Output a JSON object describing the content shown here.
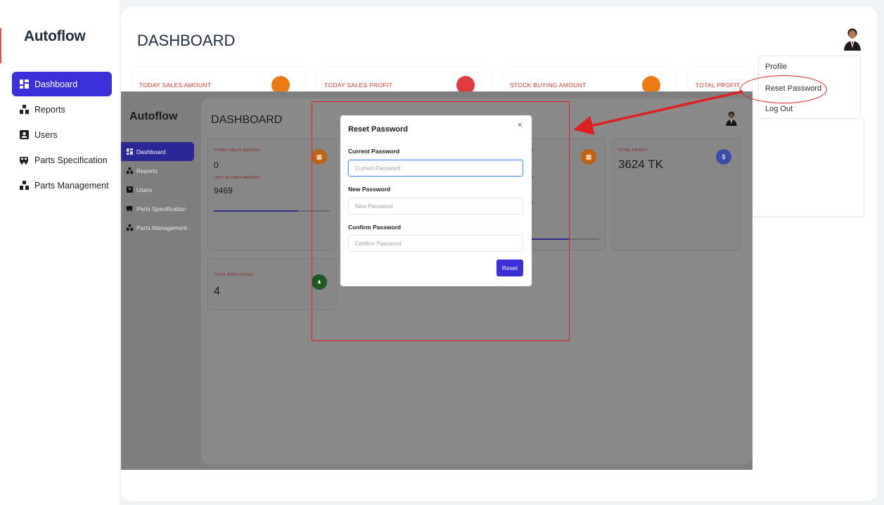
{
  "app": {
    "name": "Autoflow",
    "page_title": "DASHBOARD"
  },
  "sidebar": {
    "items": [
      {
        "label": "Dashboard",
        "icon": "dashboard-icon",
        "active": true
      },
      {
        "label": "Reports",
        "icon": "reports-icon",
        "active": false
      },
      {
        "label": "Users",
        "icon": "users-icon",
        "active": false
      },
      {
        "label": "Parts Specification",
        "icon": "car-icon",
        "active": false
      },
      {
        "label": "Parts Management",
        "icon": "parts-icon",
        "active": false
      }
    ]
  },
  "cards": [
    {
      "label": "TODAY SALES AMOUNT",
      "color": "#f07a12"
    },
    {
      "label": "TODAY SALES PROFIT",
      "color": "#e0393e"
    },
    {
      "label": "STOCK BUYING AMOUNT",
      "color": "#f07a12"
    },
    {
      "label": "TOTAL PROFIT",
      "color": "#4a5fe0"
    }
  ],
  "profile_menu": {
    "items": [
      "Profile",
      "Reset Password",
      "Log Out"
    ],
    "highlighted": "Reset Password"
  },
  "overlay": {
    "app_name": "Autoflow",
    "page_title": "DASHBOARD",
    "sidebar": [
      "Dashboard",
      "Reports",
      "Users",
      "Parts Specification",
      "Parts Management"
    ],
    "card_sales": {
      "label": "TODAY SALES AMOUNT",
      "value": "0",
      "sub_label": "LAST 30 DAYS AMOUNT",
      "sub_value": "9469",
      "progress": 0.73
    },
    "card_profit": {
      "label": "TOTAL PROFIT",
      "value": "3624 TK",
      "icon": "$"
    },
    "card_employees": {
      "label": "TOTAL EMPLOYEES",
      "value": "4"
    },
    "partial_labels": [
      "T",
      "T",
      "T"
    ],
    "colors": {
      "orange": "#c0620f",
      "blue": "#3d4ca6",
      "green": "#1d5a24"
    }
  },
  "modal": {
    "title": "Reset Password",
    "close": "×",
    "fields": [
      {
        "label": "Current Password",
        "placeholder": "Current Password"
      },
      {
        "label": "New Password",
        "placeholder": "New Password"
      },
      {
        "label": "Confirm Password",
        "placeholder": "Confirm Password"
      }
    ],
    "submit_label": "Reset"
  },
  "annotation_color": "#e02020"
}
